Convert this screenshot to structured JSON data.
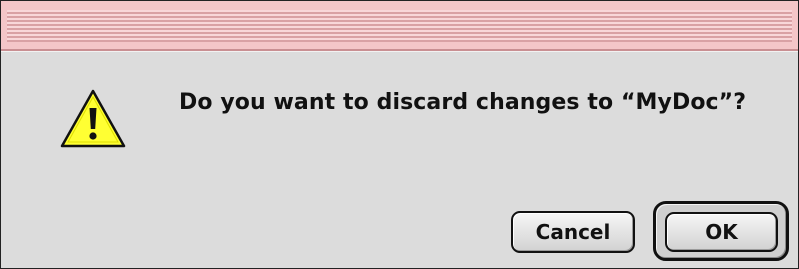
{
  "dialog": {
    "message": "Do you want to discard changes to “MyDoc”?",
    "icon": "warning-triangle-icon",
    "buttons": {
      "cancel_label": "Cancel",
      "ok_label": "OK"
    }
  },
  "colors": {
    "titlebar": "#f4c6c8",
    "titlebar_stripe": "#d9a1a4",
    "body": "#dcdcdc",
    "warning_yellow": "#ffff33"
  }
}
